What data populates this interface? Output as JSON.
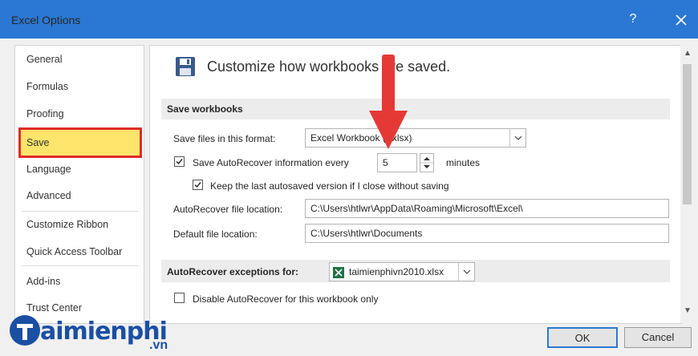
{
  "window": {
    "title": "Excel Options",
    "help": "?"
  },
  "nav": {
    "items": [
      "General",
      "Formulas",
      "Proofing",
      "Save",
      "Language",
      "Advanced",
      "Customize Ribbon",
      "Quick Access Toolbar",
      "Add-ins",
      "Trust Center"
    ],
    "selected": "Save"
  },
  "header": {
    "title": "Customize how workbooks are saved.",
    "icon": "floppy-disk-icon"
  },
  "save_workbooks": {
    "section_title": "Save workbooks",
    "format_label": "Save files in this format:",
    "format_value": "Excel Workbook (*.xlsx)",
    "autorecover_label": "Save AutoRecover information every",
    "autorecover_checked": true,
    "autorecover_minutes": "5",
    "minutes_label": "minutes",
    "keep_last_label": "Keep the last autosaved version if I close without saving",
    "keep_last_checked": true,
    "autorecover_location_label": "AutoRecover file location:",
    "autorecover_location_value": "C:\\Users\\htlwr\\AppData\\Roaming\\Microsoft\\Excel\\",
    "default_location_label": "Default file location:",
    "default_location_value": "C:\\Users\\htlwr\\Documents"
  },
  "exceptions": {
    "section_title": "AutoRecover exceptions for:",
    "workbook_value": "taimienphivn2010.xlsx",
    "disable_label": "Disable AutoRecover for this workbook only",
    "disable_checked": false
  },
  "buttons": {
    "ok": "OK",
    "cancel": "Cancel"
  },
  "watermark": {
    "brand": "aimienphi",
    "suffix": ".vn"
  },
  "colors": {
    "titlebar": "#2b78d4",
    "selected_nav": "#fde46b",
    "highlight_border": "#e02b2b",
    "arrow": "#e53935"
  }
}
